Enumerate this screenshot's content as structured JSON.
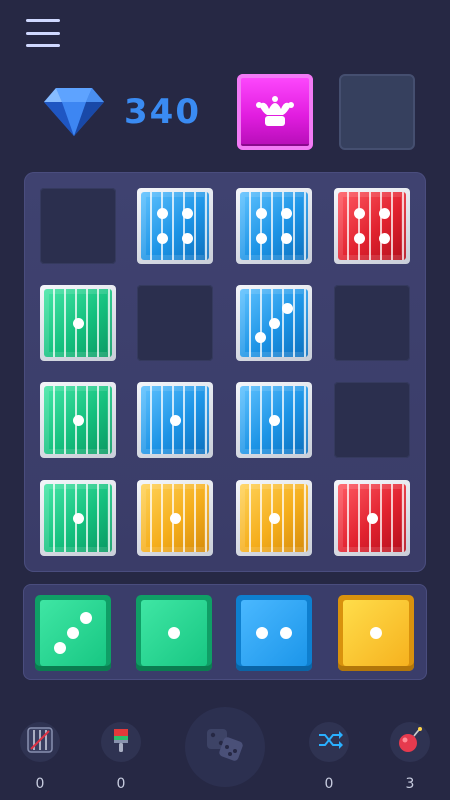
{
  "header": {
    "menu_icon": "hamburger-menu-icon",
    "gem_icon": "diamond-icon",
    "gem_count": "340",
    "hold_slots": [
      {
        "content": "joker-icon",
        "color": "#e11ddf"
      },
      {
        "content": "empty"
      }
    ]
  },
  "board": {
    "rows": 4,
    "cols": 4,
    "cells": [
      [
        {
          "state": "empty"
        },
        {
          "color": "blue",
          "pips": 4,
          "caged": true
        },
        {
          "color": "blue",
          "pips": 4,
          "caged": true
        },
        {
          "color": "red",
          "pips": 4,
          "caged": true
        }
      ],
      [
        {
          "color": "green",
          "pips": 1,
          "caged": true
        },
        {
          "state": "empty"
        },
        {
          "color": "blue",
          "pips": 3,
          "caged": true
        },
        {
          "state": "empty"
        }
      ],
      [
        {
          "color": "green",
          "pips": 1,
          "caged": true
        },
        {
          "color": "blue",
          "pips": 1,
          "caged": true
        },
        {
          "color": "blue",
          "pips": 1,
          "caged": true
        },
        {
          "state": "empty"
        }
      ],
      [
        {
          "color": "green",
          "pips": 1,
          "caged": true
        },
        {
          "color": "yellow",
          "pips": 1,
          "caged": true
        },
        {
          "color": "yellow",
          "pips": 1,
          "caged": true
        },
        {
          "color": "red",
          "pips": 1,
          "caged": true
        }
      ]
    ]
  },
  "tray": {
    "pieces": [
      {
        "color": "green",
        "pips": 3
      },
      {
        "color": "green",
        "pips": 1
      },
      {
        "color": "blue",
        "pips": 2
      },
      {
        "color": "yellow",
        "pips": 1
      }
    ]
  },
  "toolbar": {
    "items": [
      {
        "icon": "cage-breaker-icon",
        "count": "0"
      },
      {
        "icon": "paint-brush-icon",
        "count": "0"
      },
      {
        "icon": "dice-roll-icon"
      },
      {
        "icon": "shuffle-icon",
        "count": "0"
      },
      {
        "icon": "bomb-icon",
        "count": "3"
      }
    ]
  },
  "colors": {
    "background": "#262844",
    "score": "#3a8bf2",
    "blue": "#1d94e6",
    "red": "#e1222f",
    "green": "#15c07e",
    "yellow": "#f5ae1c",
    "joker": "#e11ddf"
  }
}
